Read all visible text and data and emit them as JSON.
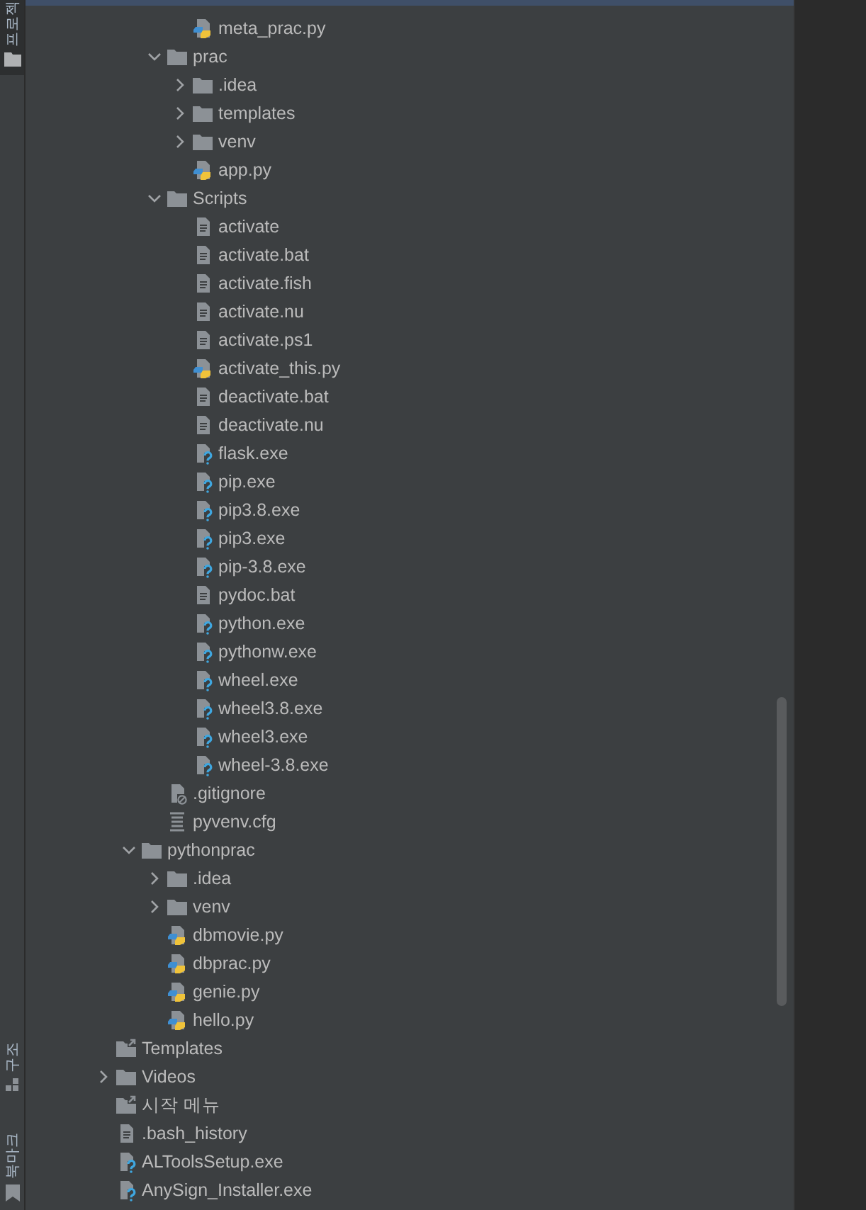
{
  "side_tabs": [
    {
      "label": "프로젝",
      "selected": true
    },
    {
      "label": "구조",
      "selected": false
    },
    {
      "label": "북마크",
      "selected": false
    }
  ],
  "tree": [
    {
      "children": [
        {
          "children": [
            {
              "children": [
                {
                  "name": "meta_prac.py",
                  "kind": "python"
                }
              ]
            },
            {
              "name": "prac",
              "kind": "folder",
              "expanded": true,
              "children": [
                {
                  "name": ".idea",
                  "kind": "folder",
                  "expanded": false
                },
                {
                  "name": "templates",
                  "kind": "folder",
                  "expanded": false
                },
                {
                  "name": "venv",
                  "kind": "folder",
                  "expanded": false
                },
                {
                  "name": "app.py",
                  "kind": "python"
                }
              ]
            },
            {
              "name": "Scripts",
              "kind": "folder",
              "expanded": true,
              "children": [
                {
                  "name": "activate",
                  "kind": "text"
                },
                {
                  "name": "activate.bat",
                  "kind": "text"
                },
                {
                  "name": "activate.fish",
                  "kind": "text"
                },
                {
                  "name": "activate.nu",
                  "kind": "text"
                },
                {
                  "name": "activate.ps1",
                  "kind": "text"
                },
                {
                  "name": "activate_this.py",
                  "kind": "python"
                },
                {
                  "name": "deactivate.bat",
                  "kind": "text"
                },
                {
                  "name": "deactivate.nu",
                  "kind": "text"
                },
                {
                  "name": "flask.exe",
                  "kind": "exe"
                },
                {
                  "name": "pip.exe",
                  "kind": "exe"
                },
                {
                  "name": "pip3.8.exe",
                  "kind": "exe"
                },
                {
                  "name": "pip3.exe",
                  "kind": "exe"
                },
                {
                  "name": "pip-3.8.exe",
                  "kind": "exe"
                },
                {
                  "name": "pydoc.bat",
                  "kind": "text"
                },
                {
                  "name": "python.exe",
                  "kind": "exe"
                },
                {
                  "name": "pythonw.exe",
                  "kind": "exe"
                },
                {
                  "name": "wheel.exe",
                  "kind": "exe"
                },
                {
                  "name": "wheel3.8.exe",
                  "kind": "exe"
                },
                {
                  "name": "wheel3.exe",
                  "kind": "exe"
                },
                {
                  "name": "wheel-3.8.exe",
                  "kind": "exe"
                }
              ]
            },
            {
              "name": ".gitignore",
              "kind": "gitignore"
            },
            {
              "name": "pyvenv.cfg",
              "kind": "cfg"
            }
          ]
        },
        {
          "name": "pythonprac",
          "kind": "folder",
          "expanded": true,
          "children": [
            {
              "name": ".idea",
              "kind": "folder",
              "expanded": false
            },
            {
              "name": "venv",
              "kind": "folder",
              "expanded": false
            },
            {
              "name": "dbmovie.py",
              "kind": "python"
            },
            {
              "name": "dbprac.py",
              "kind": "python"
            },
            {
              "name": "genie.py",
              "kind": "python"
            },
            {
              "name": "hello.py",
              "kind": "python"
            }
          ]
        }
      ]
    },
    {
      "name": "Templates",
      "kind": "link"
    },
    {
      "name": "Videos",
      "kind": "folder",
      "expanded": false
    },
    {
      "name": "시작 메뉴",
      "kind": "link"
    },
    {
      "name": ".bash_history",
      "kind": "text"
    },
    {
      "name": "ALToolsSetup.exe",
      "kind": "exe"
    },
    {
      "name": "AnySign_Installer.exe",
      "kind": "exe"
    }
  ]
}
